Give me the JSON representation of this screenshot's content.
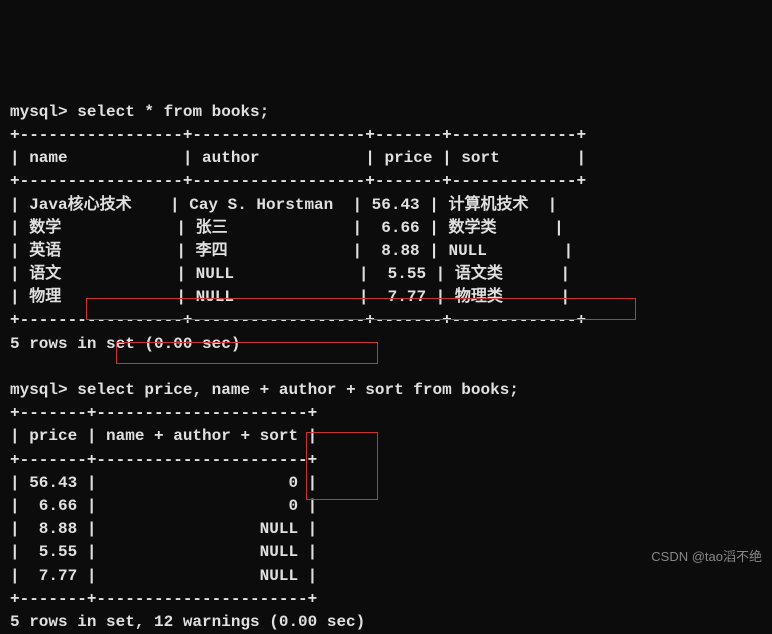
{
  "prompt": "mysql>",
  "query1": {
    "sql": "select * from books;",
    "divider": "+-----------------+------------------+-------+-------------+",
    "header": "| name            | author           | price | sort        |",
    "rows": [
      "| Java核心技术    | Cay S. Horstman  | 56.43 | 计算机技术  |",
      "| 数学            | 张三             |  6.66 | 数学类      |",
      "| 英语            | 李四             |  8.88 | NULL        |",
      "| 语文            | NULL             |  5.55 | 语文类      |",
      "| 物理            | NULL             |  7.77 | 物理类      |"
    ],
    "footer": "5 rows in set (0.00 sec)"
  },
  "query2": {
    "sql": "select price, name + author + sort from books;",
    "divider": "+-------+----------------------+",
    "header": "| price | name + author + sort |",
    "rows": [
      "| 56.43 |                    0 |",
      "|  6.66 |                    0 |",
      "|  8.88 |                 NULL |",
      "|  5.55 |                 NULL |",
      "|  7.77 |                 NULL |"
    ],
    "footer": "5 rows in set, 12 warnings (0.00 sec)"
  },
  "watermark": "CSDN @tao滔不绝",
  "chart_data": {
    "type": "table",
    "tables": [
      {
        "query": "select * from books;",
        "columns": [
          "name",
          "author",
          "price",
          "sort"
        ],
        "rows": [
          {
            "name": "Java核心技术",
            "author": "Cay S. Horstman",
            "price": 56.43,
            "sort": "计算机技术"
          },
          {
            "name": "数学",
            "author": "张三",
            "price": 6.66,
            "sort": "数学类"
          },
          {
            "name": "英语",
            "author": "李四",
            "price": 8.88,
            "sort": null
          },
          {
            "name": "语文",
            "author": null,
            "price": 5.55,
            "sort": "语文类"
          },
          {
            "name": "物理",
            "author": null,
            "price": 7.77,
            "sort": "物理类"
          }
        ],
        "result_info": {
          "rows": 5,
          "time_sec": 0.0
        }
      },
      {
        "query": "select price, name + author + sort from books;",
        "columns": [
          "price",
          "name + author + sort"
        ],
        "rows": [
          {
            "price": 56.43,
            "name + author + sort": 0
          },
          {
            "price": 6.66,
            "name + author + sort": 0
          },
          {
            "price": 8.88,
            "name + author + sort": null
          },
          {
            "price": 5.55,
            "name + author + sort": null
          },
          {
            "price": 7.77,
            "name + author + sort": null
          }
        ],
        "result_info": {
          "rows": 5,
          "warnings": 12,
          "time_sec": 0.0
        }
      }
    ]
  }
}
